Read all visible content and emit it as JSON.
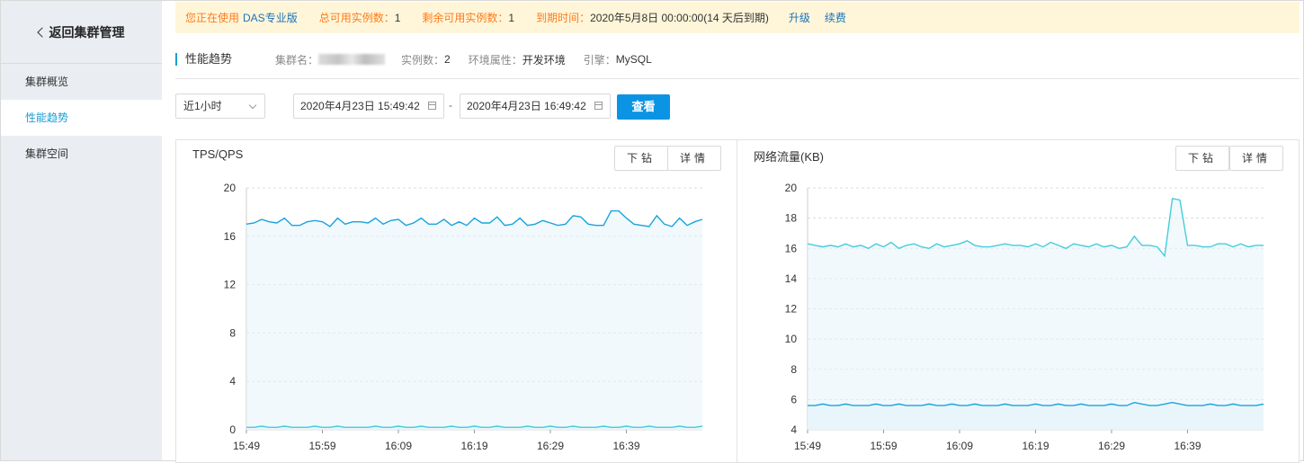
{
  "sidebar": {
    "back_label": "返回集群管理",
    "items": [
      {
        "label": "集群概览",
        "active": false
      },
      {
        "label": "性能趋势",
        "active": true
      },
      {
        "label": "集群空间",
        "active": false
      }
    ]
  },
  "notice": {
    "using_prefix": "您正在使用",
    "edition": "DAS专业版",
    "total_label": "总可用实例数：",
    "total_value": "1",
    "remaining_label": "剩余可用实例数：",
    "remaining_value": "1",
    "expire_label": "到期时间：",
    "expire_value": "2020年5月8日 00:00:00(14 天后到期)",
    "upgrade_link": "升级",
    "renew_link": "续费"
  },
  "info": {
    "title": "性能趋势",
    "cluster_name_label": "集群名：",
    "instances_label": "实例数：",
    "instances_value": "2",
    "env_label": "环境属性：",
    "env_value": "开发环境",
    "engine_label": "引擎：",
    "engine_value": "MySQL"
  },
  "filters": {
    "range": "近1小时",
    "start": "2020年4月23日 15:49:42",
    "end": "2020年4月23日 16:49:42",
    "separator": "-",
    "view_button": "查看"
  },
  "colors": {
    "accent": "#1a9ed5",
    "primary_button": "#0b94e4",
    "line_dark": "#1aa3dd",
    "line_light": "#46ccdb",
    "notice_bg": "#fff6d9",
    "notice_text": "#ff7a1a"
  },
  "panels": [
    {
      "title": "TPS/QPS",
      "drill_label": "下钻",
      "detail_label": "详情"
    },
    {
      "title": "网络流量(KB)",
      "drill_label": "下钻",
      "detail_label": "详情"
    }
  ],
  "chart_data": [
    {
      "type": "area",
      "title": "TPS/QPS",
      "x_ticks": [
        "15:49",
        "15:59",
        "16:09",
        "16:19",
        "16:29",
        "16:39"
      ],
      "ylim": [
        0,
        20
      ],
      "y_ticks": [
        0,
        4,
        8,
        12,
        16,
        20
      ],
      "grid": true,
      "series": [
        {
          "values": [
            17.0,
            17.1,
            17.4,
            17.2,
            17.1,
            17.5,
            16.9,
            16.9,
            17.2,
            17.3,
            17.2,
            16.8,
            17.5,
            17.0,
            17.2,
            17.2,
            17.1,
            17.5,
            17.0,
            17.3,
            17.4,
            16.9,
            17.1,
            17.5,
            17.0,
            17.0,
            17.4,
            16.9,
            17.2,
            16.9,
            17.5,
            17.1,
            17.1,
            17.6,
            16.9,
            17.0,
            17.5,
            16.9,
            17.0,
            17.3,
            17.1,
            16.9,
            17.0,
            17.7,
            17.6,
            17.0,
            16.9,
            16.9,
            18.1,
            18.1,
            17.5,
            17.0,
            16.9,
            16.8,
            17.7,
            17.0,
            16.8,
            17.5,
            16.9,
            17.2,
            17.4
          ]
        },
        {
          "values": [
            0.2,
            0.2,
            0.3,
            0.2,
            0.2,
            0.3,
            0.2,
            0.2,
            0.2,
            0.3,
            0.2,
            0.2,
            0.3,
            0.2,
            0.2,
            0.2,
            0.2,
            0.3,
            0.2,
            0.2,
            0.3,
            0.2,
            0.2,
            0.3,
            0.2,
            0.2,
            0.2,
            0.3,
            0.2,
            0.2,
            0.3,
            0.2,
            0.2,
            0.3,
            0.2,
            0.2,
            0.2,
            0.3,
            0.2,
            0.2,
            0.3,
            0.2,
            0.2,
            0.3,
            0.2,
            0.2,
            0.2,
            0.3,
            0.2,
            0.2,
            0.3,
            0.2,
            0.2,
            0.3,
            0.2,
            0.2,
            0.2,
            0.3,
            0.2,
            0.2,
            0.3
          ]
        }
      ]
    },
    {
      "type": "area",
      "title": "网络流量(KB)",
      "x_ticks": [
        "15:49",
        "15:59",
        "16:09",
        "16:19",
        "16:29",
        "16:39"
      ],
      "ylim": [
        4,
        20
      ],
      "y_ticks": [
        4,
        6,
        8,
        10,
        12,
        14,
        16,
        18,
        20
      ],
      "grid": true,
      "series": [
        {
          "values": [
            16.3,
            16.2,
            16.1,
            16.2,
            16.1,
            16.3,
            16.1,
            16.2,
            16.0,
            16.3,
            16.1,
            16.4,
            16.0,
            16.2,
            16.3,
            16.1,
            16.0,
            16.3,
            16.1,
            16.2,
            16.3,
            16.5,
            16.2,
            16.1,
            16.1,
            16.2,
            16.3,
            16.2,
            16.2,
            16.1,
            16.3,
            16.1,
            16.4,
            16.2,
            16.0,
            16.3,
            16.2,
            16.1,
            16.3,
            16.1,
            16.2,
            16.0,
            16.1,
            16.8,
            16.2,
            16.2,
            16.1,
            15.5,
            19.3,
            19.2,
            16.2,
            16.2,
            16.1,
            16.1,
            16.3,
            16.3,
            16.1,
            16.3,
            16.1,
            16.2,
            16.2
          ]
        },
        {
          "values": [
            5.6,
            5.6,
            5.7,
            5.6,
            5.6,
            5.7,
            5.6,
            5.6,
            5.6,
            5.7,
            5.6,
            5.6,
            5.7,
            5.6,
            5.6,
            5.6,
            5.7,
            5.6,
            5.6,
            5.7,
            5.6,
            5.6,
            5.7,
            5.6,
            5.6,
            5.6,
            5.7,
            5.6,
            5.6,
            5.6,
            5.7,
            5.6,
            5.6,
            5.7,
            5.6,
            5.6,
            5.7,
            5.6,
            5.6,
            5.6,
            5.7,
            5.6,
            5.6,
            5.8,
            5.7,
            5.6,
            5.6,
            5.7,
            5.8,
            5.7,
            5.6,
            5.6,
            5.6,
            5.7,
            5.6,
            5.6,
            5.7,
            5.6,
            5.6,
            5.6,
            5.7
          ]
        }
      ]
    }
  ]
}
